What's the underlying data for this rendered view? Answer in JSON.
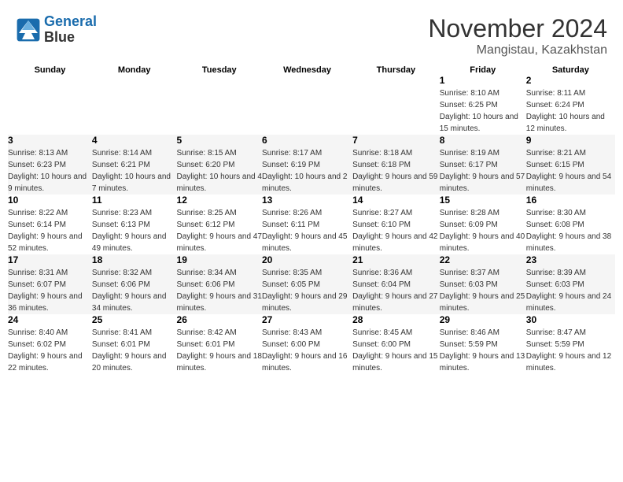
{
  "header": {
    "logo_line1": "General",
    "logo_line2": "Blue",
    "month": "November 2024",
    "location": "Mangistau, Kazakhstan"
  },
  "weekdays": [
    "Sunday",
    "Monday",
    "Tuesday",
    "Wednesday",
    "Thursday",
    "Friday",
    "Saturday"
  ],
  "weeks": [
    [
      {
        "day": "",
        "sunrise": "",
        "sunset": "",
        "daylight": ""
      },
      {
        "day": "",
        "sunrise": "",
        "sunset": "",
        "daylight": ""
      },
      {
        "day": "",
        "sunrise": "",
        "sunset": "",
        "daylight": ""
      },
      {
        "day": "",
        "sunrise": "",
        "sunset": "",
        "daylight": ""
      },
      {
        "day": "",
        "sunrise": "",
        "sunset": "",
        "daylight": ""
      },
      {
        "day": "1",
        "sunrise": "Sunrise: 8:10 AM",
        "sunset": "Sunset: 6:25 PM",
        "daylight": "Daylight: 10 hours and 15 minutes."
      },
      {
        "day": "2",
        "sunrise": "Sunrise: 8:11 AM",
        "sunset": "Sunset: 6:24 PM",
        "daylight": "Daylight: 10 hours and 12 minutes."
      }
    ],
    [
      {
        "day": "3",
        "sunrise": "Sunrise: 8:13 AM",
        "sunset": "Sunset: 6:23 PM",
        "daylight": "Daylight: 10 hours and 9 minutes."
      },
      {
        "day": "4",
        "sunrise": "Sunrise: 8:14 AM",
        "sunset": "Sunset: 6:21 PM",
        "daylight": "Daylight: 10 hours and 7 minutes."
      },
      {
        "day": "5",
        "sunrise": "Sunrise: 8:15 AM",
        "sunset": "Sunset: 6:20 PM",
        "daylight": "Daylight: 10 hours and 4 minutes."
      },
      {
        "day": "6",
        "sunrise": "Sunrise: 8:17 AM",
        "sunset": "Sunset: 6:19 PM",
        "daylight": "Daylight: 10 hours and 2 minutes."
      },
      {
        "day": "7",
        "sunrise": "Sunrise: 8:18 AM",
        "sunset": "Sunset: 6:18 PM",
        "daylight": "Daylight: 9 hours and 59 minutes."
      },
      {
        "day": "8",
        "sunrise": "Sunrise: 8:19 AM",
        "sunset": "Sunset: 6:17 PM",
        "daylight": "Daylight: 9 hours and 57 minutes."
      },
      {
        "day": "9",
        "sunrise": "Sunrise: 8:21 AM",
        "sunset": "Sunset: 6:15 PM",
        "daylight": "Daylight: 9 hours and 54 minutes."
      }
    ],
    [
      {
        "day": "10",
        "sunrise": "Sunrise: 8:22 AM",
        "sunset": "Sunset: 6:14 PM",
        "daylight": "Daylight: 9 hours and 52 minutes."
      },
      {
        "day": "11",
        "sunrise": "Sunrise: 8:23 AM",
        "sunset": "Sunset: 6:13 PM",
        "daylight": "Daylight: 9 hours and 49 minutes."
      },
      {
        "day": "12",
        "sunrise": "Sunrise: 8:25 AM",
        "sunset": "Sunset: 6:12 PM",
        "daylight": "Daylight: 9 hours and 47 minutes."
      },
      {
        "day": "13",
        "sunrise": "Sunrise: 8:26 AM",
        "sunset": "Sunset: 6:11 PM",
        "daylight": "Daylight: 9 hours and 45 minutes."
      },
      {
        "day": "14",
        "sunrise": "Sunrise: 8:27 AM",
        "sunset": "Sunset: 6:10 PM",
        "daylight": "Daylight: 9 hours and 42 minutes."
      },
      {
        "day": "15",
        "sunrise": "Sunrise: 8:28 AM",
        "sunset": "Sunset: 6:09 PM",
        "daylight": "Daylight: 9 hours and 40 minutes."
      },
      {
        "day": "16",
        "sunrise": "Sunrise: 8:30 AM",
        "sunset": "Sunset: 6:08 PM",
        "daylight": "Daylight: 9 hours and 38 minutes."
      }
    ],
    [
      {
        "day": "17",
        "sunrise": "Sunrise: 8:31 AM",
        "sunset": "Sunset: 6:07 PM",
        "daylight": "Daylight: 9 hours and 36 minutes."
      },
      {
        "day": "18",
        "sunrise": "Sunrise: 8:32 AM",
        "sunset": "Sunset: 6:06 PM",
        "daylight": "Daylight: 9 hours and 34 minutes."
      },
      {
        "day": "19",
        "sunrise": "Sunrise: 8:34 AM",
        "sunset": "Sunset: 6:06 PM",
        "daylight": "Daylight: 9 hours and 31 minutes."
      },
      {
        "day": "20",
        "sunrise": "Sunrise: 8:35 AM",
        "sunset": "Sunset: 6:05 PM",
        "daylight": "Daylight: 9 hours and 29 minutes."
      },
      {
        "day": "21",
        "sunrise": "Sunrise: 8:36 AM",
        "sunset": "Sunset: 6:04 PM",
        "daylight": "Daylight: 9 hours and 27 minutes."
      },
      {
        "day": "22",
        "sunrise": "Sunrise: 8:37 AM",
        "sunset": "Sunset: 6:03 PM",
        "daylight": "Daylight: 9 hours and 25 minutes."
      },
      {
        "day": "23",
        "sunrise": "Sunrise: 8:39 AM",
        "sunset": "Sunset: 6:03 PM",
        "daylight": "Daylight: 9 hours and 24 minutes."
      }
    ],
    [
      {
        "day": "24",
        "sunrise": "Sunrise: 8:40 AM",
        "sunset": "Sunset: 6:02 PM",
        "daylight": "Daylight: 9 hours and 22 minutes."
      },
      {
        "day": "25",
        "sunrise": "Sunrise: 8:41 AM",
        "sunset": "Sunset: 6:01 PM",
        "daylight": "Daylight: 9 hours and 20 minutes."
      },
      {
        "day": "26",
        "sunrise": "Sunrise: 8:42 AM",
        "sunset": "Sunset: 6:01 PM",
        "daylight": "Daylight: 9 hours and 18 minutes."
      },
      {
        "day": "27",
        "sunrise": "Sunrise: 8:43 AM",
        "sunset": "Sunset: 6:00 PM",
        "daylight": "Daylight: 9 hours and 16 minutes."
      },
      {
        "day": "28",
        "sunrise": "Sunrise: 8:45 AM",
        "sunset": "Sunset: 6:00 PM",
        "daylight": "Daylight: 9 hours and 15 minutes."
      },
      {
        "day": "29",
        "sunrise": "Sunrise: 8:46 AM",
        "sunset": "Sunset: 5:59 PM",
        "daylight": "Daylight: 9 hours and 13 minutes."
      },
      {
        "day": "30",
        "sunrise": "Sunrise: 8:47 AM",
        "sunset": "Sunset: 5:59 PM",
        "daylight": "Daylight: 9 hours and 12 minutes."
      }
    ]
  ]
}
